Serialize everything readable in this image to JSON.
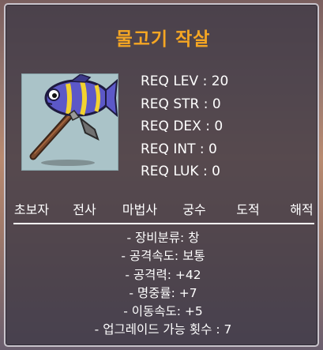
{
  "item": {
    "name": "물고기 작살",
    "icon": "fish-spear-icon"
  },
  "requirements": [
    {
      "label": "REQ LEV : 20"
    },
    {
      "label": "REQ STR : 0"
    },
    {
      "label": "REQ DEX : 0"
    },
    {
      "label": "REQ INT : 0"
    },
    {
      "label": "REQ LUK : 0"
    }
  ],
  "jobs": [
    "초보자",
    "전사",
    "마법사",
    "궁수",
    "도적",
    "해적"
  ],
  "stats": [
    "- 장비분류: 창",
    "- 공격속도: 보통",
    "- 공격력: +42",
    "- 명중률: +7",
    "- 이동속도: +5",
    "- 업그레이드 가능 횟수 : 7"
  ],
  "colors": {
    "title": "#f5a623",
    "text": "#ffffff",
    "panel": "#3e3a46",
    "border": "#c9c4cc",
    "icon_background": "#aac3c8"
  }
}
